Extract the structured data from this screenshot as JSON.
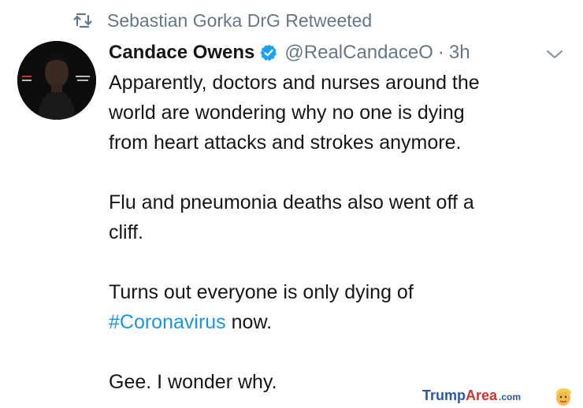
{
  "retweet": {
    "icon": "retweet-icon",
    "text": "Sebastian Gorka DrG Retweeted"
  },
  "author": {
    "avatar": "avatar",
    "name": "Candace Owens",
    "verified_icon": "verified-badge-icon",
    "handle": "@RealCandaceO",
    "separator": "·",
    "time": "3h",
    "menu_icon": "chevron-down-icon"
  },
  "tweet": {
    "paragraphs": [
      {
        "lines": [
          "Apparently, doctors and nurses around the",
          "world are wondering why no one is dying",
          "from heart attacks and strokes anymore."
        ]
      },
      {
        "lines": [
          "Flu and pneumonia deaths also went off a",
          "cliff."
        ]
      },
      {
        "line1": "Turns out everyone is only dying of",
        "hashtag": "#Coronavirus",
        "after_hashtag": " now."
      },
      {
        "lines": [
          "Gee. I wonder why."
        ]
      }
    ]
  },
  "watermark": {
    "part1": "Trump",
    "part2": "Area",
    "part3": ".com",
    "logo": "trump-face-logo"
  },
  "colors": {
    "text": "#14171a",
    "secondary": "#657786",
    "link": "#1b95e0",
    "verified": "#1da1f2"
  }
}
